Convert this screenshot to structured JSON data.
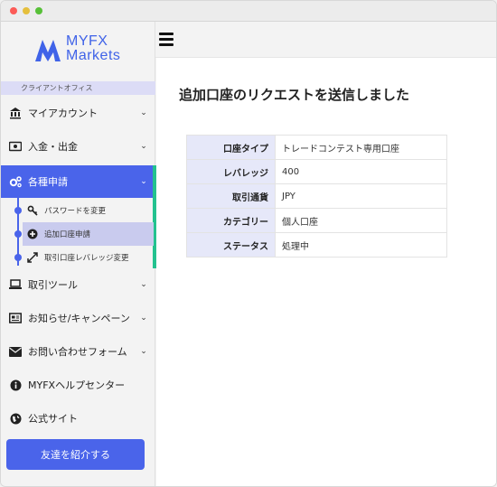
{
  "brand": {
    "line1": "MYFX",
    "line2": "Markets",
    "color": "#4063e8"
  },
  "sidebar": {
    "section_label": "クライアントオフィス",
    "items": [
      {
        "label": "マイアカウント",
        "icon": "bank-icon",
        "chevron": "⌄"
      },
      {
        "label": "入金・出金",
        "icon": "money-icon",
        "chevron": "⌄"
      },
      {
        "label": "各種申請",
        "icon": "gears-icon",
        "chevron": "⌄",
        "active": true
      },
      {
        "label": "取引ツール",
        "icon": "laptop-icon",
        "chevron": "⌄"
      },
      {
        "label": "お知らせ/キャンペーン",
        "icon": "newspaper-icon",
        "chevron": "⌄"
      },
      {
        "label": "お問い合わせフォーム",
        "icon": "envelope-icon",
        "chevron": "⌄"
      },
      {
        "label": "MYFXヘルプセンター",
        "icon": "info-icon"
      },
      {
        "label": "公式サイト",
        "icon": "globe-icon"
      }
    ],
    "subitems": [
      {
        "label": "パスワードを変更",
        "icon": "key-icon"
      },
      {
        "label": "追加口座申請",
        "icon": "plus-circle-icon",
        "current": true
      },
      {
        "label": "取引口座レバレッジ変更",
        "icon": "expand-arrows-icon"
      }
    ],
    "refer_button": "友達を紹介する"
  },
  "colors": {
    "accent": "#4a64ea",
    "active_bar": "#23c28f",
    "subitem_highlight": "#c9cbee"
  },
  "main": {
    "title": "追加口座のリクエストを送信しました",
    "table": [
      {
        "label": "口座タイプ",
        "value": "トレードコンテスト専用口座"
      },
      {
        "label": "レバレッジ",
        "value": "400"
      },
      {
        "label": "取引通貨",
        "value": "JPY"
      },
      {
        "label": "カテゴリー",
        "value": "個人口座"
      },
      {
        "label": "ステータス",
        "value": "処理中"
      }
    ]
  }
}
